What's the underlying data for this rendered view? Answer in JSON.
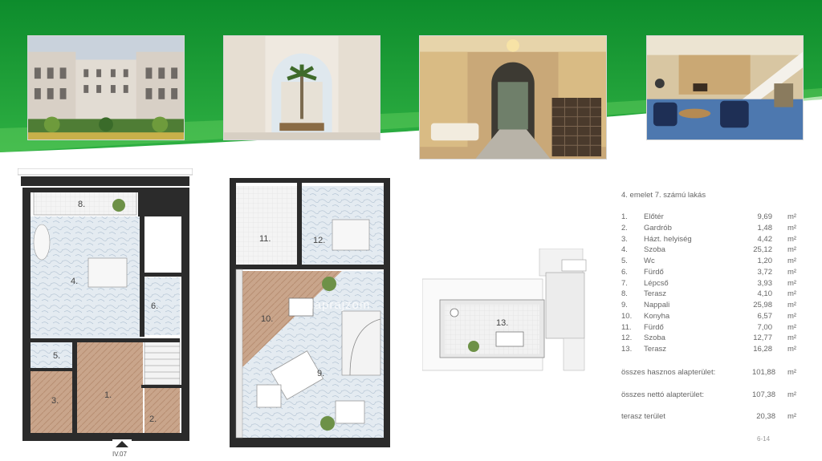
{
  "banner": {
    "color": "#0a8f2e",
    "light": "#3dbb4a"
  },
  "photos": [
    {
      "name": "courtyard-photo",
      "subject": "palace courtyard with garden"
    },
    {
      "name": "arcade-photo",
      "subject": "arched passage with palm tree"
    },
    {
      "name": "lobby-photo",
      "subject": "ornate entrance hall with mailboxes"
    },
    {
      "name": "living-room-photo",
      "subject": "furnished living room with staircase"
    }
  ],
  "watermark": "alaprajzom",
  "floorplan": {
    "lower_labels": [
      "8.",
      "4.",
      "6.",
      "5.",
      "3.",
      "1.",
      "2."
    ],
    "entrance_label": "IV.07",
    "upper_labels": [
      "11.",
      "12.",
      "10.",
      "9."
    ],
    "terrace_label": "13."
  },
  "table": {
    "title": "4. emelet 7. számú lakás",
    "rows": [
      {
        "num": "1.",
        "name": "Előtér",
        "area": "9,69",
        "unit": "m²"
      },
      {
        "num": "2.",
        "name": "Gardrób",
        "area": "1,48",
        "unit": "m²"
      },
      {
        "num": "3.",
        "name": "Házt. helyiség",
        "area": "4,42",
        "unit": "m²"
      },
      {
        "num": "4.",
        "name": "Szoba",
        "area": "25,12",
        "unit": "m²"
      },
      {
        "num": "5.",
        "name": "Wc",
        "area": "1,20",
        "unit": "m²"
      },
      {
        "num": "6.",
        "name": "Fürdő",
        "area": "3,72",
        "unit": "m²"
      },
      {
        "num": "7.",
        "name": "Lépcső",
        "area": "3,93",
        "unit": "m²"
      },
      {
        "num": "8.",
        "name": "Terasz",
        "area": "4,10",
        "unit": "m²"
      },
      {
        "num": "9.",
        "name": "Nappali",
        "area": "25,98",
        "unit": "m²"
      },
      {
        "num": "10.",
        "name": "Konyha",
        "area": "6,57",
        "unit": "m²"
      },
      {
        "num": "11.",
        "name": "Fürdő",
        "area": "7,00",
        "unit": "m²"
      },
      {
        "num": "12.",
        "name": "Szoba",
        "area": "12,77",
        "unit": "m²"
      },
      {
        "num": "13.",
        "name": "Terasz",
        "area": "16,28",
        "unit": "m²"
      }
    ],
    "totals": [
      {
        "label": "összes hasznos alapterület:",
        "value": "101,88",
        "unit": "m²"
      },
      {
        "label": "összes nettó alapterület:",
        "value": "107,38",
        "unit": "m²"
      },
      {
        "label": "terasz terület",
        "value": "20,38",
        "unit": "m²"
      }
    ],
    "page": "6-14"
  }
}
